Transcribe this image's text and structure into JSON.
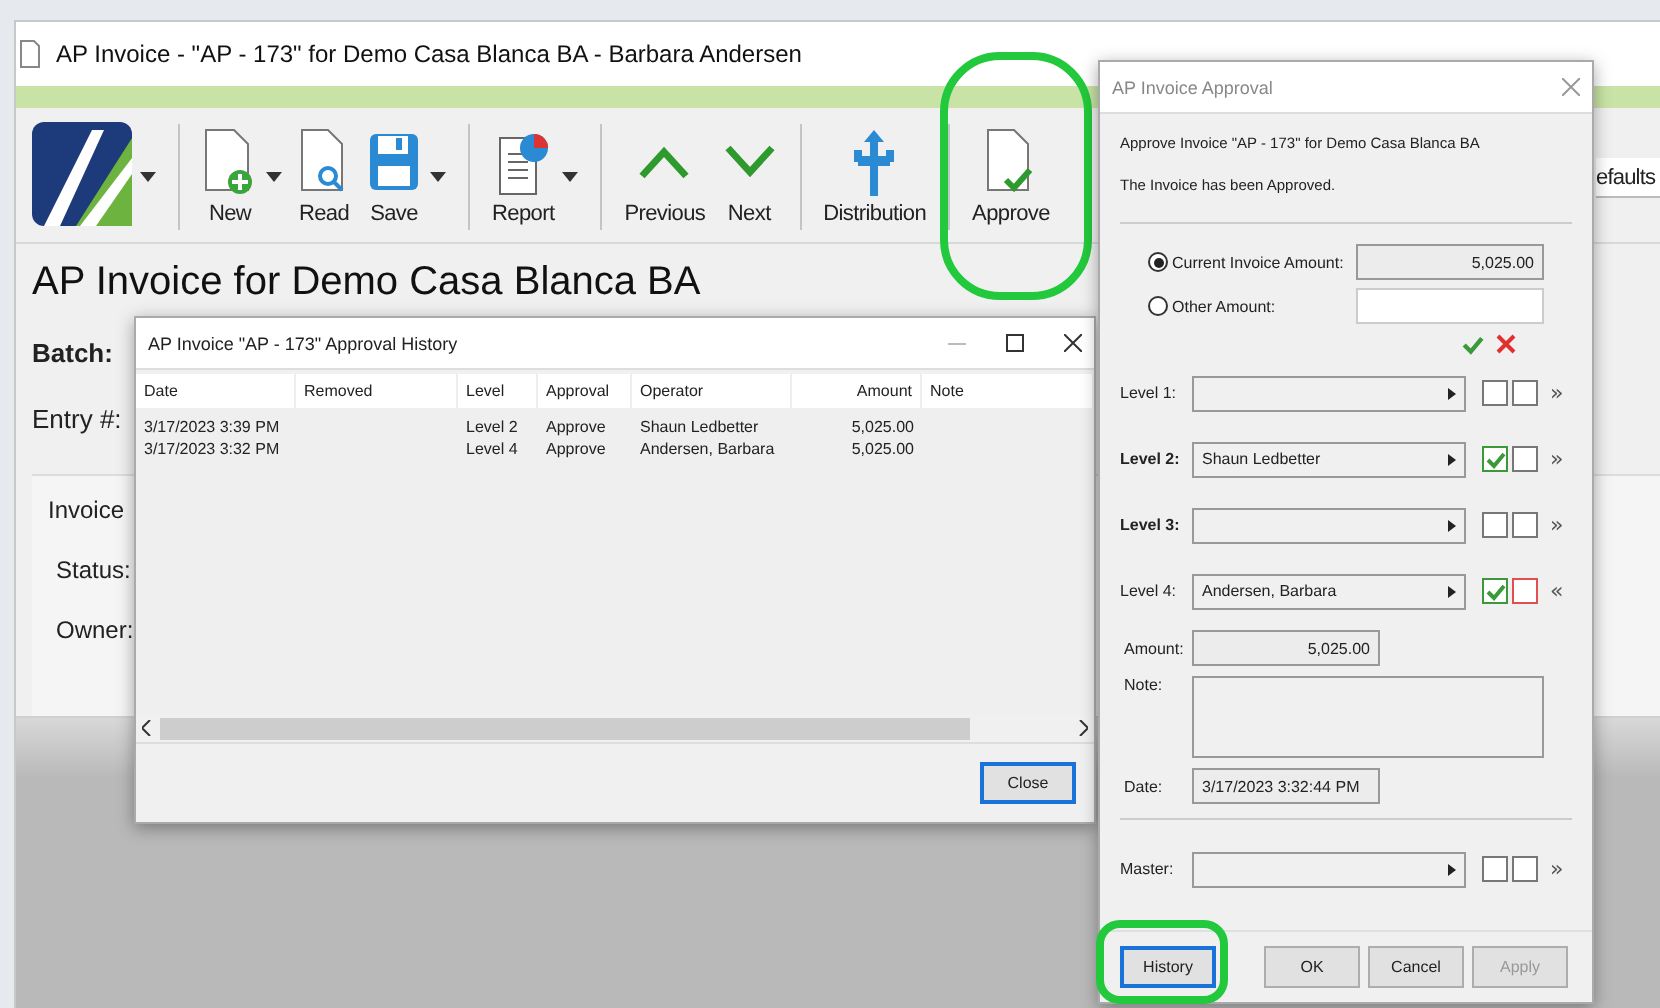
{
  "main_window": {
    "title": "AP Invoice - \"AP - 173\" for Demo Casa Blanca BA - Barbara Andersen",
    "toolbar": [
      {
        "kind": "logo",
        "dropdown": true,
        "separator_after": true
      },
      {
        "kind": "new",
        "label": "New",
        "dropdown": true,
        "separator_after": false
      },
      {
        "kind": "read",
        "label": "Read",
        "dropdown": false,
        "separator_after": false
      },
      {
        "kind": "save",
        "label": "Save",
        "dropdown": true,
        "separator_after": true
      },
      {
        "kind": "report",
        "label": "Report",
        "dropdown": true,
        "separator_after": true
      },
      {
        "kind": "previous",
        "label": "Previous",
        "dropdown": false,
        "separator_after": false
      },
      {
        "kind": "next",
        "label": "Next",
        "dropdown": false,
        "separator_after": true
      },
      {
        "kind": "distribution",
        "label": "Distribution",
        "dropdown": false,
        "separator_after": true
      },
      {
        "kind": "approve",
        "label": "Approve",
        "dropdown": false,
        "separator_after": false
      }
    ],
    "side_button": "efaults",
    "heading": "AP Invoice for Demo Casa Blanca BA",
    "fields": [
      {
        "label": "Batch:",
        "bold": true
      },
      {
        "label": "Entry #:",
        "bold": false
      }
    ],
    "group": {
      "title": "Invoice",
      "fields": [
        "Status:",
        "Owner:"
      ]
    }
  },
  "history_dialog": {
    "title": "AP Invoice \"AP - 173\" Approval History",
    "columns": [
      "Date",
      "Removed",
      "Level",
      "Approval",
      "Operator",
      "Amount",
      "Note"
    ],
    "rows": [
      [
        "3/17/2023 3:39 PM",
        "",
        "Level 2",
        "Approve",
        "Shaun Ledbetter",
        "5,025.00",
        ""
      ],
      [
        "3/17/2023 3:32 PM",
        "",
        "Level 4",
        "Approve",
        "Andersen, Barbara",
        "5,025.00",
        ""
      ]
    ],
    "close_button": "Close"
  },
  "approval_dialog": {
    "title": "AP Invoice Approval",
    "message": "Approve Invoice \"AP - 173\" for Demo Casa Blanca BA",
    "status": "The Invoice has been Approved.",
    "amount_options": [
      {
        "label": "Current Invoice Amount:",
        "selected": true,
        "value": "5,025.00"
      },
      {
        "label": "Other Amount:",
        "selected": false
      }
    ],
    "levels": [
      {
        "label": "Level 1:",
        "bold": false,
        "approved": false,
        "rejected": false,
        "color": "#777777",
        "expanded": false,
        "toggle": "»"
      },
      {
        "label": "Level 2:",
        "bold": true,
        "value": "Shaun Ledbetter",
        "approved": true,
        "rejected": false,
        "color": "#777777",
        "expanded": false,
        "toggle": "»"
      },
      {
        "label": "Level 3:",
        "bold": true,
        "approved": false,
        "rejected": false,
        "color": "#777777",
        "expanded": false,
        "toggle": "»"
      },
      {
        "label": "Level 4:",
        "bold": false,
        "value": "Andersen, Barbara",
        "approved": true,
        "rejected": false,
        "color": "#e05050",
        "expanded": true,
        "toggle": "«",
        "details": {
          "amount_label": "Amount:",
          "amount": "5,025.00",
          "note_label": "Note:",
          "date_label": "Date:",
          "date": "3/17/2023 3:32:44 PM"
        }
      }
    ],
    "master": {
      "label": "Master:",
      "approved": false,
      "rejected": false,
      "toggle": "»"
    },
    "buttons": [
      {
        "label": "History",
        "focused": true,
        "disabled": false
      },
      {
        "label": "OK",
        "focused": false,
        "disabled": false
      },
      {
        "label": "Cancel",
        "focused": false,
        "disabled": false
      },
      {
        "label": "Apply",
        "focused": false,
        "disabled": true
      }
    ]
  }
}
